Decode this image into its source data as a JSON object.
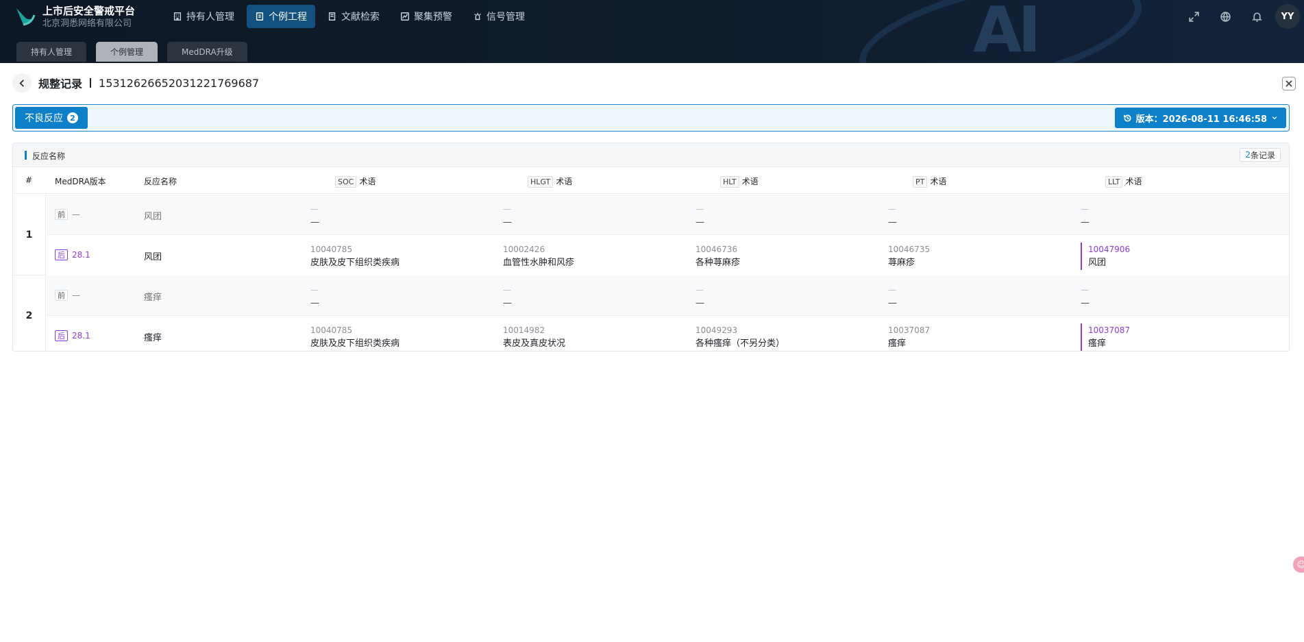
{
  "brand": {
    "title": "上市后安全警戒平台",
    "subtitle": "北京洞悉网络有限公司"
  },
  "nav": [
    {
      "label": "持有人管理",
      "icon": "building-icon"
    },
    {
      "label": "个例工程",
      "icon": "document-icon",
      "active": true
    },
    {
      "label": "文献检索",
      "icon": "book-icon"
    },
    {
      "label": "聚集预警",
      "icon": "alert-chart-icon"
    },
    {
      "label": "信号管理",
      "icon": "beacon-icon"
    }
  ],
  "user": {
    "initials": "YY"
  },
  "subtabs": [
    {
      "label": "持有人管理"
    },
    {
      "label": "个例管理",
      "active": true
    },
    {
      "label": "MedDRA升级"
    }
  ],
  "header": {
    "title": "规整记录",
    "record_id": "153126266520312217696​87"
  },
  "filter": {
    "adr_label": "不良反应",
    "adr_count": "2",
    "version_label": "版本：2026-08-11 16:46:58"
  },
  "card": {
    "title": "反应名称",
    "count_num": "2",
    "count_suffix": "条记录"
  },
  "columns": {
    "no": "#",
    "meddra": "MedDRA版本",
    "reaction": "反应名称",
    "soc_code": "SOC",
    "hlgt_code": "HLGT",
    "hlt_code": "HLT",
    "pt_code": "PT",
    "llt_code": "LLT",
    "term_suffix": "术语"
  },
  "groups": [
    {
      "no": "1",
      "before": {
        "tag": "前",
        "version": "—",
        "reaction": "风团",
        "soc": {
          "code": "—",
          "name": "—"
        },
        "hlgt": {
          "code": "—",
          "name": "—"
        },
        "hlt": {
          "code": "—",
          "name": "—"
        },
        "pt": {
          "code": "—",
          "name": "—"
        },
        "llt": {
          "code": "—",
          "name": "—"
        }
      },
      "after": {
        "tag": "后",
        "version": "28.1",
        "reaction": "风团",
        "soc": {
          "code": "10040785",
          "name": "皮肤及皮下组织类疾病"
        },
        "hlgt": {
          "code": "10002426",
          "name": "血管性水肿和风疹"
        },
        "hlt": {
          "code": "10046736",
          "name": "各种荨麻疹"
        },
        "pt": {
          "code": "10046735",
          "name": "荨麻疹"
        },
        "llt": {
          "code": "10047906",
          "name": "风团"
        }
      }
    },
    {
      "no": "2",
      "before": {
        "tag": "前",
        "version": "—",
        "reaction": "瘙痒",
        "soc": {
          "code": "—",
          "name": "—"
        },
        "hlgt": {
          "code": "—",
          "name": "—"
        },
        "hlt": {
          "code": "—",
          "name": "—"
        },
        "pt": {
          "code": "—",
          "name": "—"
        },
        "llt": {
          "code": "—",
          "name": "—"
        }
      },
      "after": {
        "tag": "后",
        "version": "28.1",
        "reaction": "瘙痒",
        "soc": {
          "code": "10040785",
          "name": "皮肤及皮下组织类疾病"
        },
        "hlgt": {
          "code": "10014982",
          "name": "表皮及真皮状况"
        },
        "hlt": {
          "code": "10049293",
          "name": "各种瘙痒（不另分类）"
        },
        "pt": {
          "code": "10037087",
          "name": "瘙痒"
        },
        "llt": {
          "code": "10037087",
          "name": "瘙痒"
        }
      }
    }
  ],
  "float_button": {
    "label": "☺"
  },
  "colors": {
    "accent": "#0e7fc9",
    "purple": "#8e3bd6",
    "topbar": "#0f1c2c"
  }
}
